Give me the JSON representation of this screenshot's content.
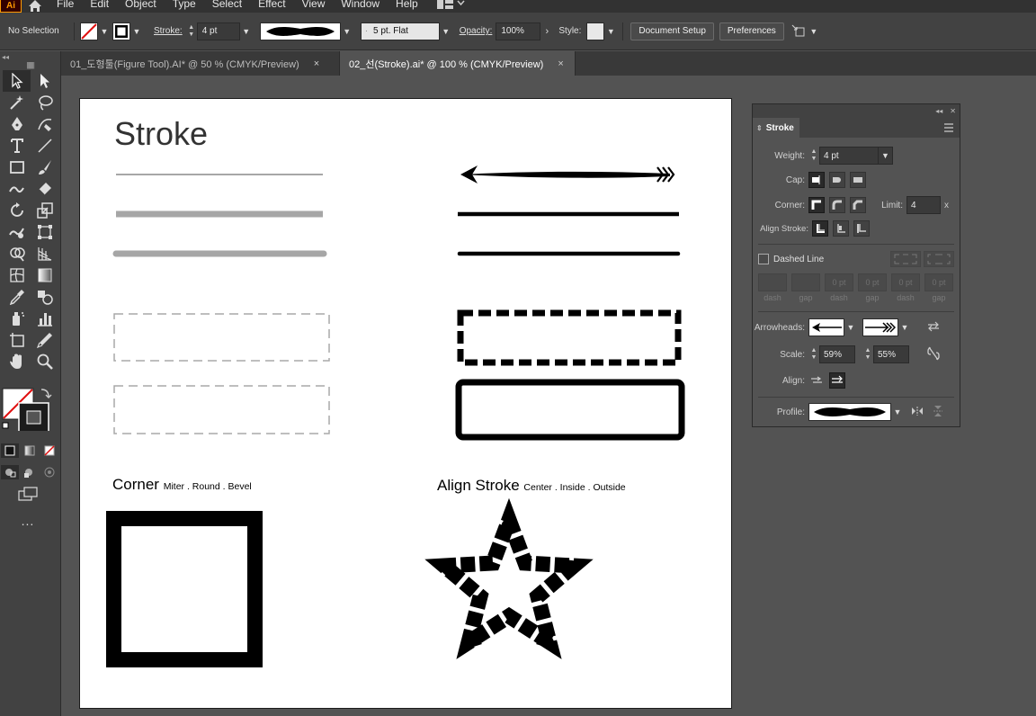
{
  "app": {
    "logo": "Ai"
  },
  "menu": [
    "File",
    "Edit",
    "Object",
    "Type",
    "Select",
    "Effect",
    "View",
    "Window",
    "Help"
  ],
  "control": {
    "selection": "No Selection",
    "stroke_label": "Stroke:",
    "stroke_weight": "4 pt",
    "brush": "5 pt. Flat",
    "opacity_label": "Opacity:",
    "opacity": "100%",
    "style_label": "Style:",
    "document_setup": "Document Setup",
    "preferences": "Preferences"
  },
  "tabs": [
    {
      "label": "01_도형툴(Figure Tool).AI* @ 50 % (CMYK/Preview)",
      "close": "×"
    },
    {
      "label": "02_선(Stroke).ai* @ 100 % (CMYK/Preview)",
      "close": "×"
    }
  ],
  "toolbar": {
    "more": "..."
  },
  "artboard": {
    "title": "Stroke",
    "corner_heading": "Corner",
    "corner_sub": "Miter . Round . Bevel",
    "align_heading": "Align Stroke",
    "align_sub": "Center . Inside . Outside"
  },
  "panel": {
    "title": "Stroke",
    "weight_label": "Weight:",
    "weight": "4 pt",
    "cap_label": "Cap:",
    "corner_label": "Corner:",
    "limit_label": "Limit:",
    "limit": "4",
    "limit_unit": "x",
    "align_label": "Align Stroke:",
    "dashed_label": "Dashed Line",
    "dash_values": [
      "",
      "",
      "0 pt",
      "0 pt",
      "0 pt",
      "0 pt"
    ],
    "dash_labels": [
      "dash",
      "gap",
      "dash",
      "gap",
      "dash",
      "gap"
    ],
    "arrowheads_label": "Arrowheads:",
    "scale_label": "Scale:",
    "scale_start": "59%",
    "scale_end": "55%",
    "align_arrow_label": "Align:",
    "profile_label": "Profile:"
  }
}
